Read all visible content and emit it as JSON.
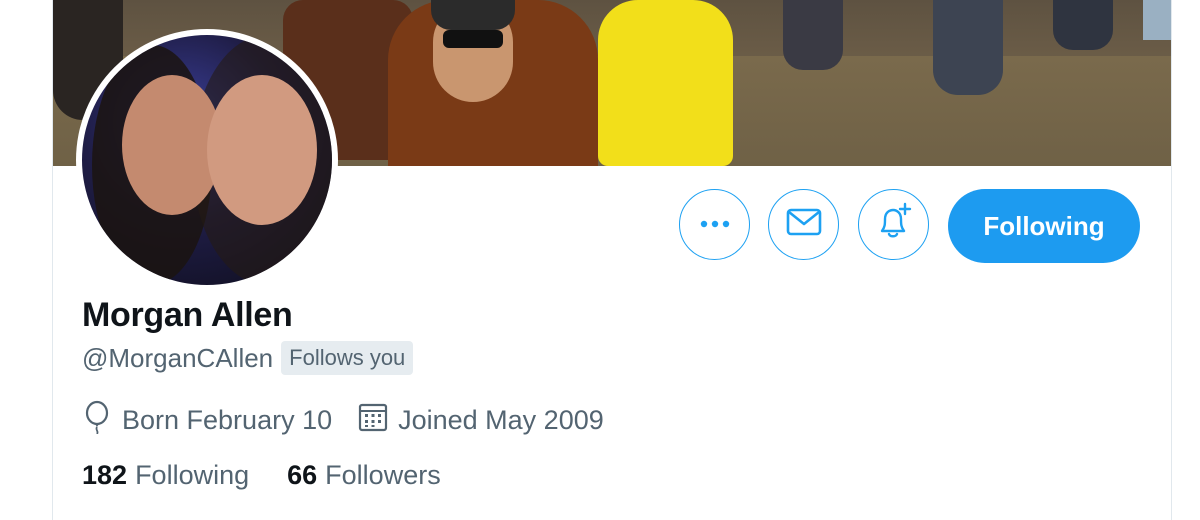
{
  "profile": {
    "name": "Morgan Allen",
    "handle": "@MorganCAllen",
    "follows_you": "Follows you",
    "birthday": "Born February 10",
    "joined": "Joined May 2009",
    "following_count": "182",
    "following_label": "Following",
    "followers_count": "66",
    "followers_label": "Followers"
  },
  "actions": {
    "more_icon": "ellipsis-icon",
    "message_icon": "envelope-icon",
    "notify_icon": "bell-plus-icon",
    "follow_button_label": "Following"
  },
  "colors": {
    "accent": "#1d9bf0",
    "text_primary": "#0f1419",
    "text_secondary": "#536471",
    "badge_bg": "#e6ecf0"
  }
}
